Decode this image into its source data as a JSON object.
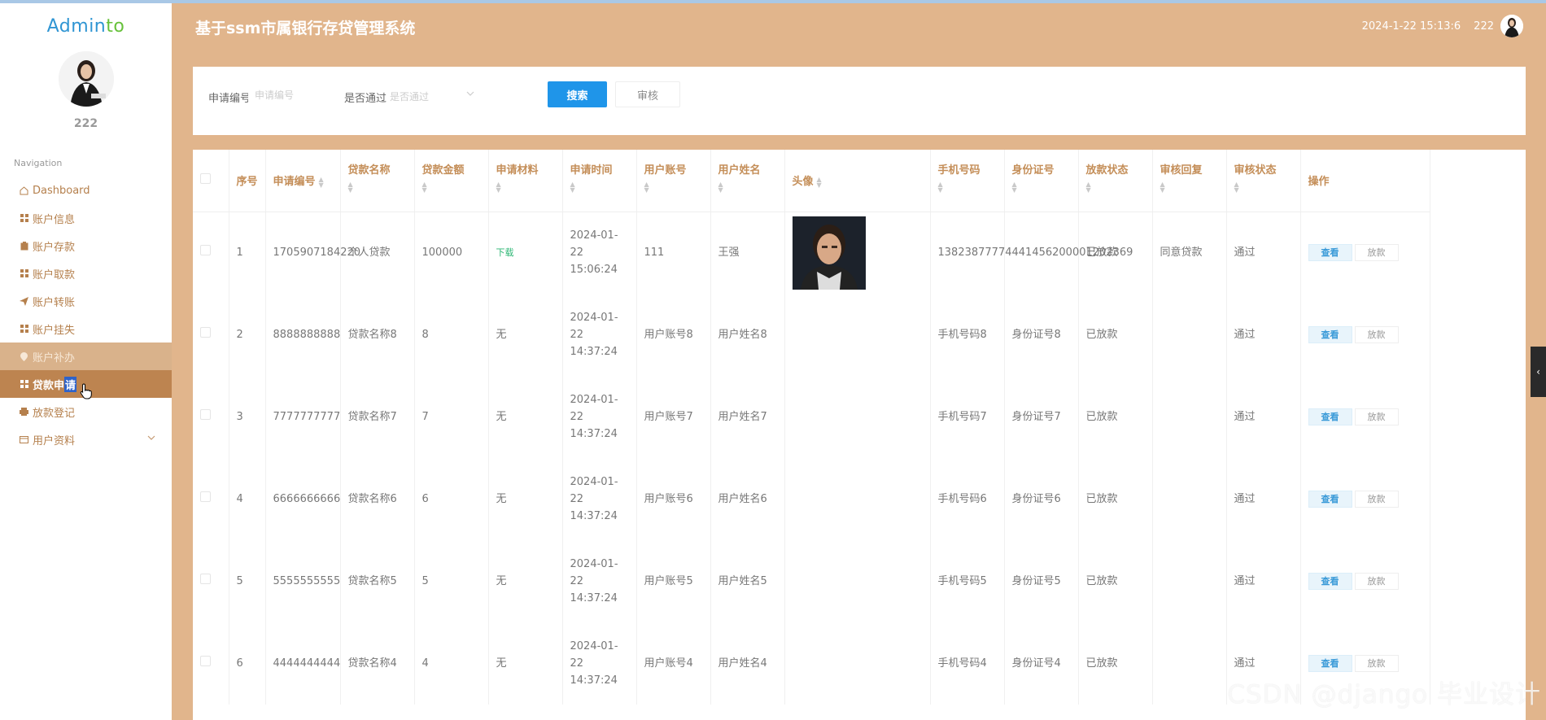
{
  "app": {
    "title": "基于ssm市属银行存贷管理系统",
    "datetime": "2024-1-22 15:13:6",
    "username": "222"
  },
  "sidebar": {
    "logo_main": "Admin",
    "logo_accent": "to",
    "username": "222",
    "nav_title": "Navigation",
    "items": [
      {
        "label": "Dashboard",
        "icon": "home-icon"
      },
      {
        "label": "账户信息",
        "icon": "grid-icon"
      },
      {
        "label": "账户存款",
        "icon": "clipboard-icon"
      },
      {
        "label": "账户取款",
        "icon": "grid-icon"
      },
      {
        "label": "账户转账",
        "icon": "send-icon"
      },
      {
        "label": "账户挂失",
        "icon": "grid-icon"
      },
      {
        "label": "账户补办",
        "icon": "location-icon"
      },
      {
        "label_a": "贷款申",
        "label_b": "请",
        "icon": "grid-icon"
      },
      {
        "label": "放款登记",
        "icon": "printer-icon"
      },
      {
        "label": "用户资料",
        "icon": "card-icon"
      }
    ]
  },
  "search": {
    "field1_label": "申请编号",
    "field1_placeholder": "申请编号",
    "field2_label": "是否通过",
    "field2_placeholder": "是否通过",
    "search_button": "搜索",
    "audit_button": "审核"
  },
  "table": {
    "headers": [
      "序号",
      "申请编号",
      "贷款名称",
      "贷款金额",
      "申请材料",
      "申请时间",
      "用户账号",
      "用户姓名",
      "头像",
      "手机号码",
      "身份证号",
      "放款状态",
      "审核回复",
      "审核状态",
      "操作"
    ],
    "view_label": "查看",
    "loan_label": "放款",
    "rows": [
      {
        "no": "1",
        "code": "1705907184220",
        "name": "个人贷款",
        "amount": "100000",
        "material": "下载",
        "time": "2024-01-22 15:06:24",
        "account": "111",
        "uname": "王强",
        "phone": "13823877774",
        "idno": "441456200001202369",
        "loan_status": "已放款",
        "reply": "同意贷款",
        "audit": "通过"
      },
      {
        "no": "2",
        "code": "8888888888",
        "name": "贷款名称8",
        "amount": "8",
        "material": "无",
        "time": "2024-01-22 14:37:24",
        "account": "用户账号8",
        "uname": "用户姓名8",
        "phone": "手机号码8",
        "idno": "身份证号8",
        "loan_status": "已放款",
        "reply": "",
        "audit": "通过"
      },
      {
        "no": "3",
        "code": "7777777777",
        "name": "贷款名称7",
        "amount": "7",
        "material": "无",
        "time": "2024-01-22 14:37:24",
        "account": "用户账号7",
        "uname": "用户姓名7",
        "phone": "手机号码7",
        "idno": "身份证号7",
        "loan_status": "已放款",
        "reply": "",
        "audit": "通过"
      },
      {
        "no": "4",
        "code": "6666666666",
        "name": "贷款名称6",
        "amount": "6",
        "material": "无",
        "time": "2024-01-22 14:37:24",
        "account": "用户账号6",
        "uname": "用户姓名6",
        "phone": "手机号码6",
        "idno": "身份证号6",
        "loan_status": "已放款",
        "reply": "",
        "audit": "通过"
      },
      {
        "no": "5",
        "code": "5555555555",
        "name": "贷款名称5",
        "amount": "5",
        "material": "无",
        "time": "2024-01-22 14:37:24",
        "account": "用户账号5",
        "uname": "用户姓名5",
        "phone": "手机号码5",
        "idno": "身份证号5",
        "loan_status": "已放款",
        "reply": "",
        "audit": "通过"
      },
      {
        "no": "6",
        "code": "4444444444",
        "name": "贷款名称4",
        "amount": "4",
        "material": "无",
        "time": "2024-01-22 14:37:24",
        "account": "用户账号4",
        "uname": "用户姓名4",
        "phone": "手机号码4",
        "idno": "身份证号4",
        "loan_status": "已放款",
        "reply": "",
        "audit": "通过"
      }
    ]
  },
  "watermark": "CSDN @django 毕业设计",
  "colors": {
    "theme": "#e1b58c",
    "active_nav": "#bd8450",
    "header_text": "#c48e58",
    "primary_button": "#1f95e9"
  }
}
